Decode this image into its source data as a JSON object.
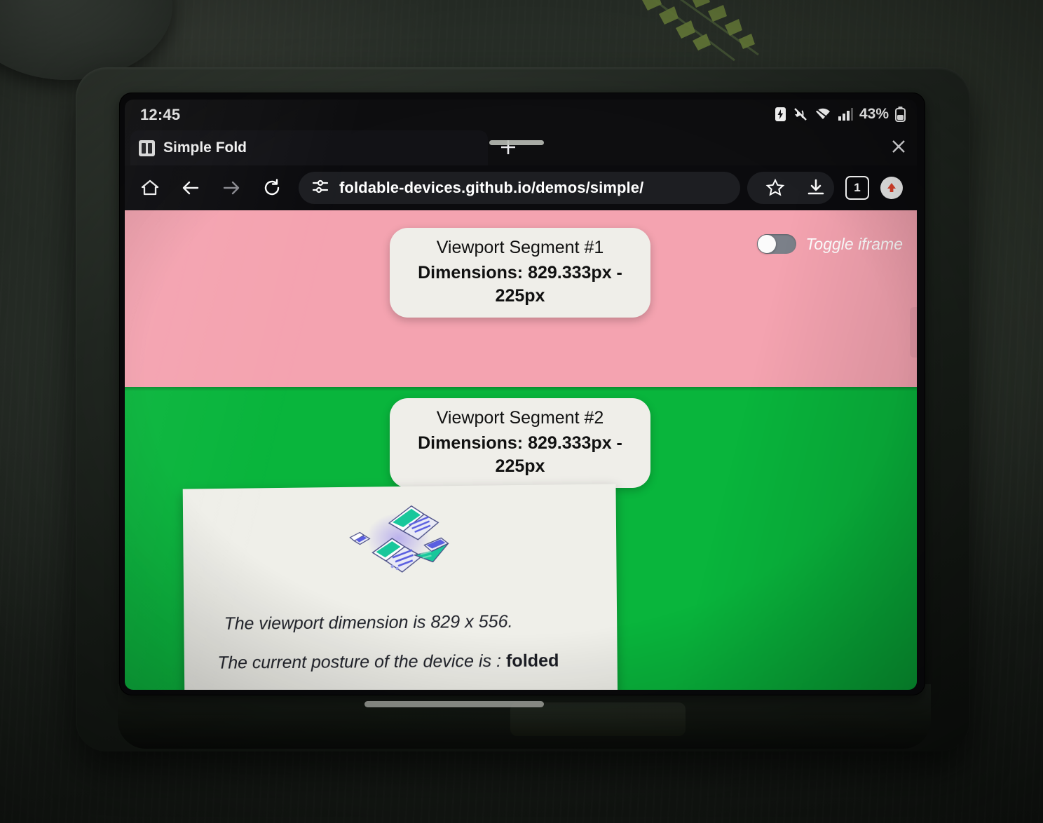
{
  "status_bar": {
    "clock": "12:45",
    "battery_percent": "43%",
    "icons": [
      "battery-saver-icon",
      "vibrate-off-icon",
      "wifi-icon",
      "cellular-signal-icon",
      "battery-icon"
    ]
  },
  "browser": {
    "tab": {
      "title": "Simple Fold",
      "favicon": "simple-fold-favicon",
      "close_icon": "close-icon"
    },
    "new_tab_icon": "plus-icon",
    "toolbar": {
      "home_icon": "home-icon",
      "back_icon": "back-arrow-icon",
      "forward_icon": "forward-arrow-icon",
      "reload_icon": "reload-icon",
      "site_settings_icon": "tune-icon",
      "url": "foldable-devices.github.io/demos/simple/",
      "bookmark_icon": "star-icon",
      "download_icon": "download-icon",
      "tab_count": "1",
      "profile_icon": "incognito-avatar-icon"
    }
  },
  "page": {
    "segment_1": {
      "title": "Viewport Segment #1",
      "dimensions": "Dimensions: 829.333px - 225px",
      "background_color": "#f4a3b0"
    },
    "segment_2": {
      "title": "Viewport Segment #2",
      "dimensions": "Dimensions: 829.333px - 225px",
      "background_color": "#09b53c"
    },
    "toggle_iframe": {
      "label": "Toggle iframe",
      "state": "off"
    },
    "info_card": {
      "illustration": "foldable-devices-illustration",
      "viewport_line": "The viewport dimension is 829 x 556.",
      "posture_line": "The current posture of the device is : ",
      "posture_value": "folded"
    }
  },
  "device": {
    "top_speaker_grille": "speaker-grille",
    "bottom_speaker_grille": "speaker-grille",
    "side_button": "power-button"
  }
}
